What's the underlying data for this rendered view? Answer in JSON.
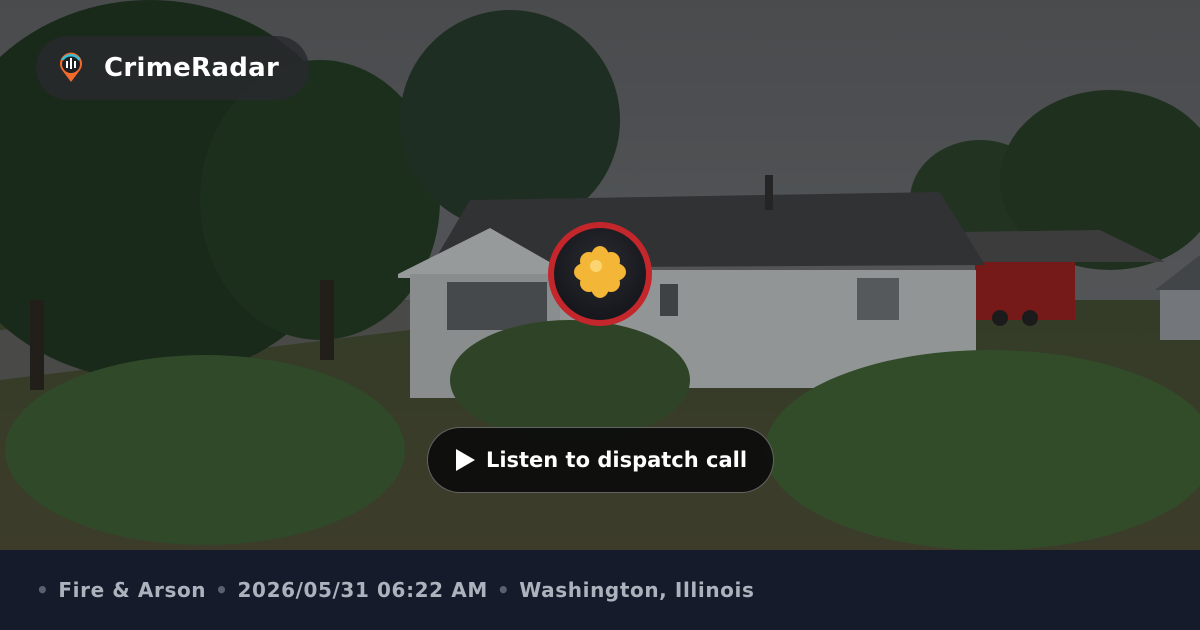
{
  "brand": {
    "name": "CrimeRadar",
    "logo_icon": "radar-pin-icon"
  },
  "marker": {
    "category_icon": "fire-burst-icon",
    "ring_color": "#c3262b"
  },
  "play_button": {
    "label": "Listen to dispatch call",
    "icon": "play-icon"
  },
  "footer": {
    "separator": "•",
    "category": "Fire & Arson",
    "timestamp": "2026/05/31 06:22 AM",
    "location": "Washington, Illinois"
  }
}
